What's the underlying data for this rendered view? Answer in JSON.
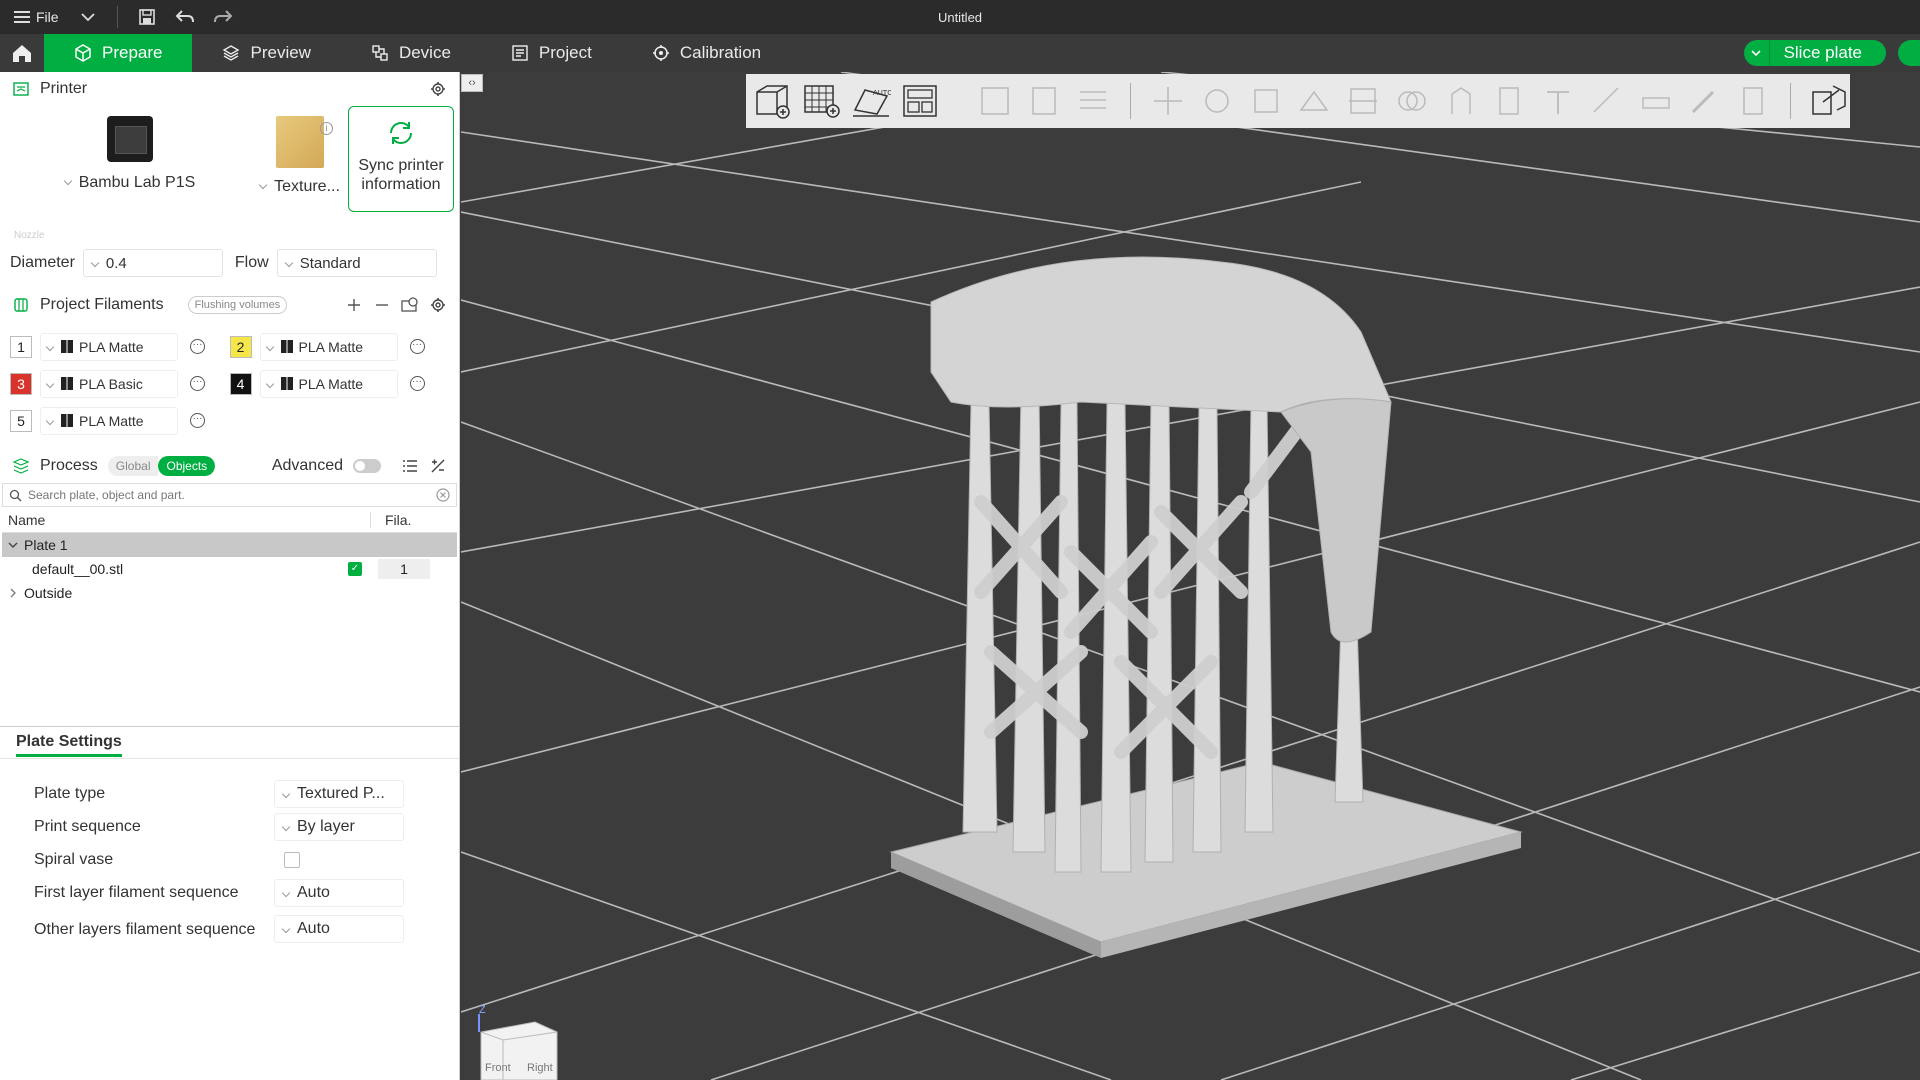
{
  "titlebar": {
    "file_label": "File",
    "title": "Untitled"
  },
  "tabs": [
    {
      "label": "Prepare",
      "icon": "cube-icon"
    },
    {
      "label": "Preview",
      "icon": "layers-icon"
    },
    {
      "label": "Device",
      "icon": "device-icon"
    },
    {
      "label": "Project",
      "icon": "project-icon"
    },
    {
      "label": "Calibration",
      "icon": "calibration-icon"
    }
  ],
  "slice_button": "Slice plate",
  "printer": {
    "section_title": "Printer",
    "printer_name": "Bambu Lab P1S",
    "plate_name": "Texture...",
    "sync_label_line1": "Sync printer",
    "sync_label_line2": "information",
    "nozzle_label": "Nozzle",
    "diameter_label": "Diameter",
    "diameter_value": "0.4",
    "flow_label": "Flow",
    "flow_value": "Standard"
  },
  "filaments": {
    "section_title": "Project Filaments",
    "flushing_label": "Flushing volumes",
    "items": [
      {
        "num": "1",
        "name": "PLA Matte",
        "color": "#ffffff",
        "text_color": "#222222"
      },
      {
        "num": "2",
        "name": "PLA Matte",
        "color": "#f5e64a",
        "text_color": "#222222"
      },
      {
        "num": "3",
        "name": "PLA Basic",
        "color": "#d9342b",
        "text_color": "#ffffff"
      },
      {
        "num": "4",
        "name": "PLA Matte",
        "color": "#111111",
        "text_color": "#ffffff"
      },
      {
        "num": "5",
        "name": "PLA Matte",
        "color": "#ffffff",
        "text_color": "#222222"
      }
    ]
  },
  "process": {
    "section_title": "Process",
    "global_label": "Global",
    "objects_label": "Objects",
    "advanced_label": "Advanced",
    "search_placeholder": "Search plate, object and part.",
    "col_name": "Name",
    "col_fila": "Fila.",
    "tree": [
      {
        "label": "Plate 1",
        "type": "plate"
      },
      {
        "label": "default__00.stl",
        "type": "object",
        "fila": "1"
      },
      {
        "label": "Outside",
        "type": "group"
      }
    ]
  },
  "plate_settings": {
    "tab_label": "Plate Settings",
    "rows": [
      {
        "label": "Plate type",
        "value": "Textured P..."
      },
      {
        "label": "Print sequence",
        "value": "By layer"
      },
      {
        "label": "Spiral vase",
        "value": ""
      },
      {
        "label": "First layer filament sequence",
        "value": "Auto"
      },
      {
        "label": "Other layers filament sequence",
        "value": "Auto"
      }
    ]
  },
  "view_cube": {
    "axis": "Z",
    "front": "Front",
    "right": "Right"
  },
  "colors": {
    "accent": "#00ae42",
    "viewport_bg": "#3c3c3c",
    "model": "#d9d9d9"
  }
}
